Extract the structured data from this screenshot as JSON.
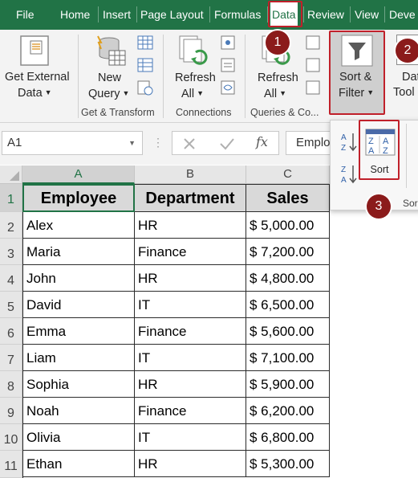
{
  "tabs": [
    {
      "label": "File"
    },
    {
      "label": "Home"
    },
    {
      "label": "Insert"
    },
    {
      "label": "Page Layout"
    },
    {
      "label": "Formulas"
    },
    {
      "label": "Data"
    },
    {
      "label": "Review"
    },
    {
      "label": "View"
    },
    {
      "label": "Deve"
    }
  ],
  "ribbon": {
    "get_external": {
      "line1": "Get External",
      "line2": "Data"
    },
    "new_query": {
      "line1": "New",
      "line2": "Query"
    },
    "refresh_conn": {
      "line1": "Refresh",
      "line2": "All"
    },
    "refresh_query": {
      "line1": "Refresh",
      "line2": "All"
    },
    "sort_filter": {
      "line1": "Sort &",
      "line2": "Filter"
    },
    "data_tools": {
      "line1": "Dat",
      "line2": "Tool"
    },
    "groups": {
      "get_transform": "Get & Transform",
      "connections": "Connections",
      "queries": "Queries & Co..."
    }
  },
  "formula_bar": {
    "name_box": "A1",
    "fx": "fx",
    "content": "Emplo"
  },
  "dropdown": {
    "sort_label": "Sort",
    "group_label": "Sor"
  },
  "columns": [
    "A",
    "B",
    "C"
  ],
  "headers": {
    "employee": "Employee",
    "department": "Department",
    "sales": "Sales"
  },
  "rows": [
    {
      "num": "1"
    },
    {
      "num": "2",
      "name": "Alex",
      "dept": "HR",
      "sales": "$ 5,000.00"
    },
    {
      "num": "3",
      "name": "Maria",
      "dept": "Finance",
      "sales": "$ 7,200.00"
    },
    {
      "num": "4",
      "name": "John",
      "dept": "HR",
      "sales": "$ 4,800.00"
    },
    {
      "num": "5",
      "name": "David",
      "dept": "IT",
      "sales": "$ 6,500.00"
    },
    {
      "num": "6",
      "name": "Emma",
      "dept": "Finance",
      "sales": "$ 5,600.00"
    },
    {
      "num": "7",
      "name": "Liam",
      "dept": "IT",
      "sales": "$ 7,100.00"
    },
    {
      "num": "8",
      "name": "Sophia",
      "dept": "HR",
      "sales": "$ 5,900.00"
    },
    {
      "num": "9",
      "name": "Noah",
      "dept": "Finance",
      "sales": "$ 6,200.00"
    },
    {
      "num": "10",
      "name": "Olivia",
      "dept": "IT",
      "sales": "$ 6,800.00"
    },
    {
      "num": "11",
      "name": "Ethan",
      "dept": "HR",
      "sales": "$ 5,300.00"
    }
  ],
  "badges": [
    "1",
    "2",
    "3"
  ],
  "colors": {
    "excel_green": "#217346",
    "annotation_red": "#c0202a",
    "badge": "#8b1b1b"
  }
}
